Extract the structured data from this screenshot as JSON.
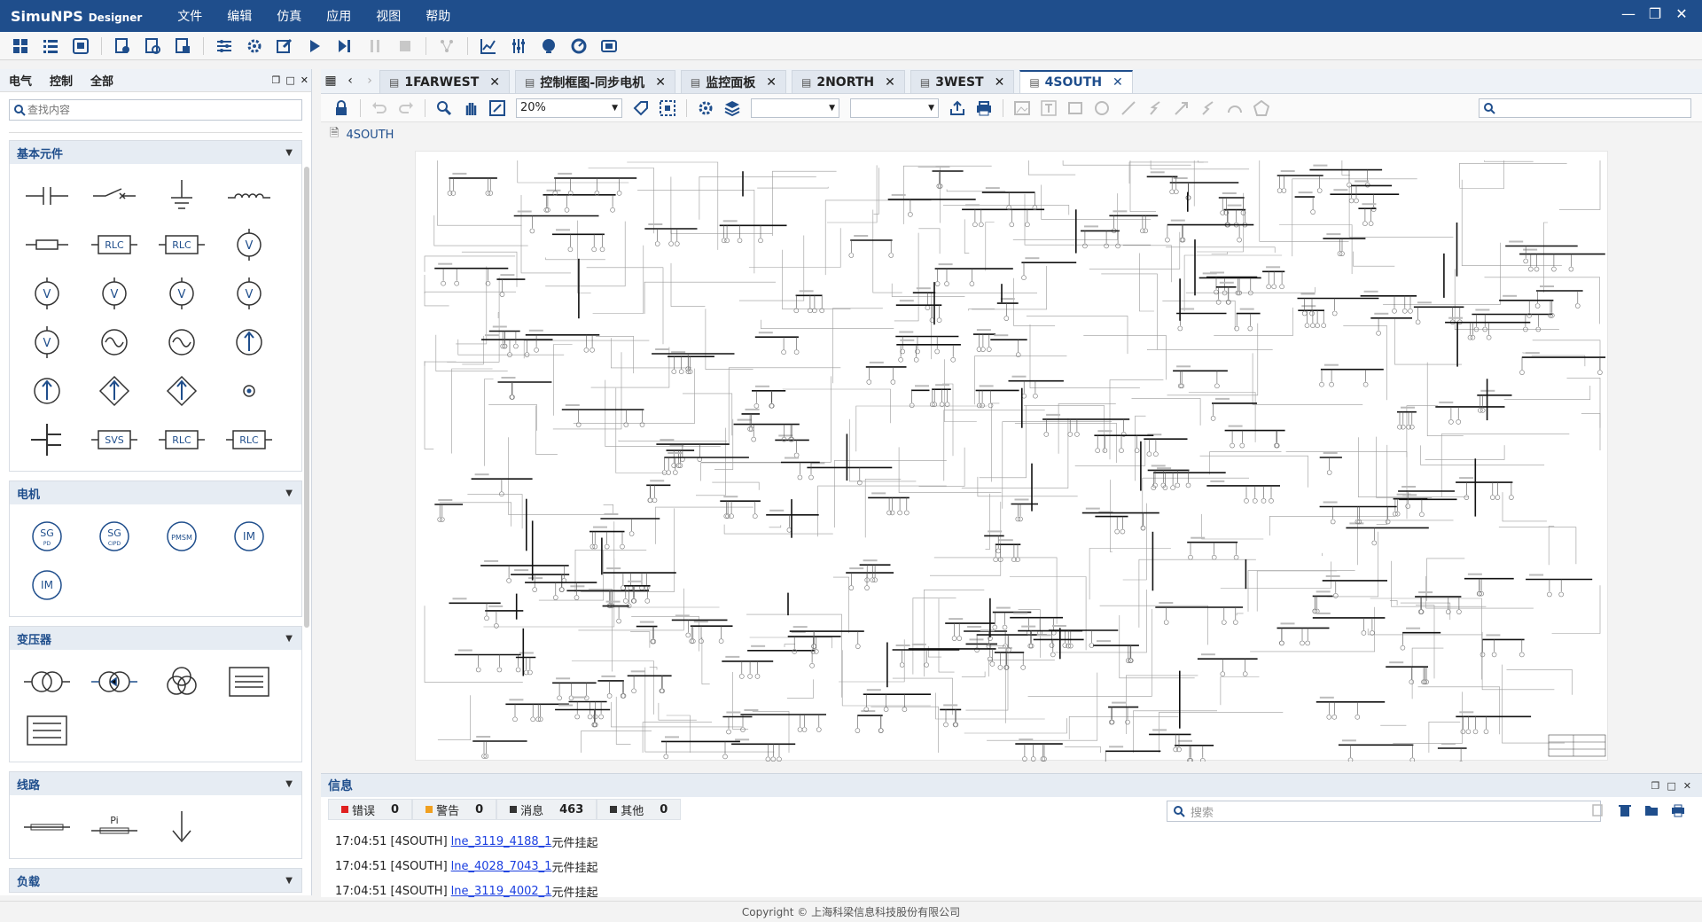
{
  "app": {
    "brand": "SimuNPS",
    "brand_sub": "Designer",
    "menu": [
      "文件",
      "编辑",
      "仿真",
      "应用",
      "视图",
      "帮助"
    ],
    "accent": "#1f4e8c"
  },
  "left_panel": {
    "tabs": [
      "电气",
      "控制",
      "全部"
    ],
    "search_placeholder": "查找内容",
    "groups": [
      {
        "title": "基本元件",
        "items": [
          {
            "icon": "capacitor-icon"
          },
          {
            "icon": "switch-icon"
          },
          {
            "icon": "ground-icon"
          },
          {
            "icon": "inductor-icon"
          },
          {
            "icon": "resistor-icon"
          },
          {
            "icon": "rlc-branch-icon",
            "label": "RLC"
          },
          {
            "icon": "rlc-load-icon",
            "label": "RLC"
          },
          {
            "icon": "voltage-meter-icon",
            "label": "V"
          },
          {
            "icon": "voltage-source-icon",
            "label": "V"
          },
          {
            "icon": "voltage-source-dc-icon",
            "label": "V"
          },
          {
            "icon": "voltage-source-ac-icon",
            "label": "V"
          },
          {
            "icon": "controlled-voltage-icon",
            "label": "V"
          },
          {
            "icon": "controlled-voltage-dc-icon",
            "label": "V"
          },
          {
            "icon": "ac-source-icon"
          },
          {
            "icon": "ac-source-alt-icon"
          },
          {
            "icon": "current-source-icon"
          },
          {
            "icon": "current-source-dc-icon"
          },
          {
            "icon": "controlled-current-icon"
          },
          {
            "icon": "controlled-current-alt-icon"
          },
          {
            "icon": "node-icon"
          },
          {
            "icon": "bus-icon"
          },
          {
            "icon": "svs-icon",
            "label": "SVS"
          },
          {
            "icon": "rlc-series-icon",
            "label": "RLC"
          },
          {
            "icon": "rlc-parallel-icon",
            "label": "RLC"
          }
        ]
      },
      {
        "title": "电机",
        "items": [
          {
            "icon": "sg-pd-icon",
            "label": "SG",
            "sub": "PD"
          },
          {
            "icon": "sg-cipd-icon",
            "label": "SG",
            "sub": "CIPD"
          },
          {
            "icon": "pmsm-icon",
            "label": "PMSM"
          },
          {
            "icon": "im-icon",
            "label": "IM"
          },
          {
            "icon": "im-alt-icon",
            "label": "IM"
          }
        ]
      },
      {
        "title": "变压器",
        "items": [
          {
            "icon": "transformer-2w-icon"
          },
          {
            "icon": "transformer-phase-icon"
          },
          {
            "icon": "transformer-3w-icon"
          },
          {
            "icon": "transformer-core-icon"
          },
          {
            "icon": "transformer-core-3w-icon"
          }
        ]
      },
      {
        "title": "线路",
        "items": [
          {
            "icon": "line-icon"
          },
          {
            "icon": "pi-line-icon",
            "label": "Pi"
          },
          {
            "icon": "load-arrow-icon"
          }
        ]
      },
      {
        "title": "负载",
        "items": []
      }
    ]
  },
  "tabs": [
    {
      "label": "1FARWEST",
      "icon": "diagram-icon",
      "active": false
    },
    {
      "label": "控制框图-同步电机",
      "icon": "control-diagram-icon",
      "active": false
    },
    {
      "label": "监控面板",
      "icon": "monitor-panel-icon",
      "active": false
    },
    {
      "label": "2NORTH",
      "icon": "diagram-icon",
      "active": false
    },
    {
      "label": "3WEST",
      "icon": "diagram-icon",
      "active": false
    },
    {
      "label": "4SOUTH",
      "icon": "diagram-icon",
      "active": true
    }
  ],
  "editor": {
    "zoom": "20%",
    "breadcrumb": "4SOUTH"
  },
  "info": {
    "title": "信息",
    "filters": [
      {
        "label": "错误",
        "count": "0",
        "color": "#e02020"
      },
      {
        "label": "警告",
        "count": "0",
        "color": "#f0a020"
      },
      {
        "label": "消息",
        "count": "463",
        "color": "#333333"
      },
      {
        "label": "其他",
        "count": "0",
        "color": "#333333"
      }
    ],
    "search_placeholder": "搜索",
    "logs": [
      {
        "time": "17:04:51 [4SOUTH]",
        "link": "lne_3119_4188_1",
        "msg": "元件挂起"
      },
      {
        "time": "17:04:51 [4SOUTH]",
        "link": "lne_4028_7043_1",
        "msg": "元件挂起"
      },
      {
        "time": "17:04:51 [4SOUTH]",
        "link": "lne_3119_4002_1",
        "msg": "元件挂起"
      }
    ]
  },
  "status": {
    "copyright": "Copyright © 上海科梁信息科技股份有限公司"
  }
}
